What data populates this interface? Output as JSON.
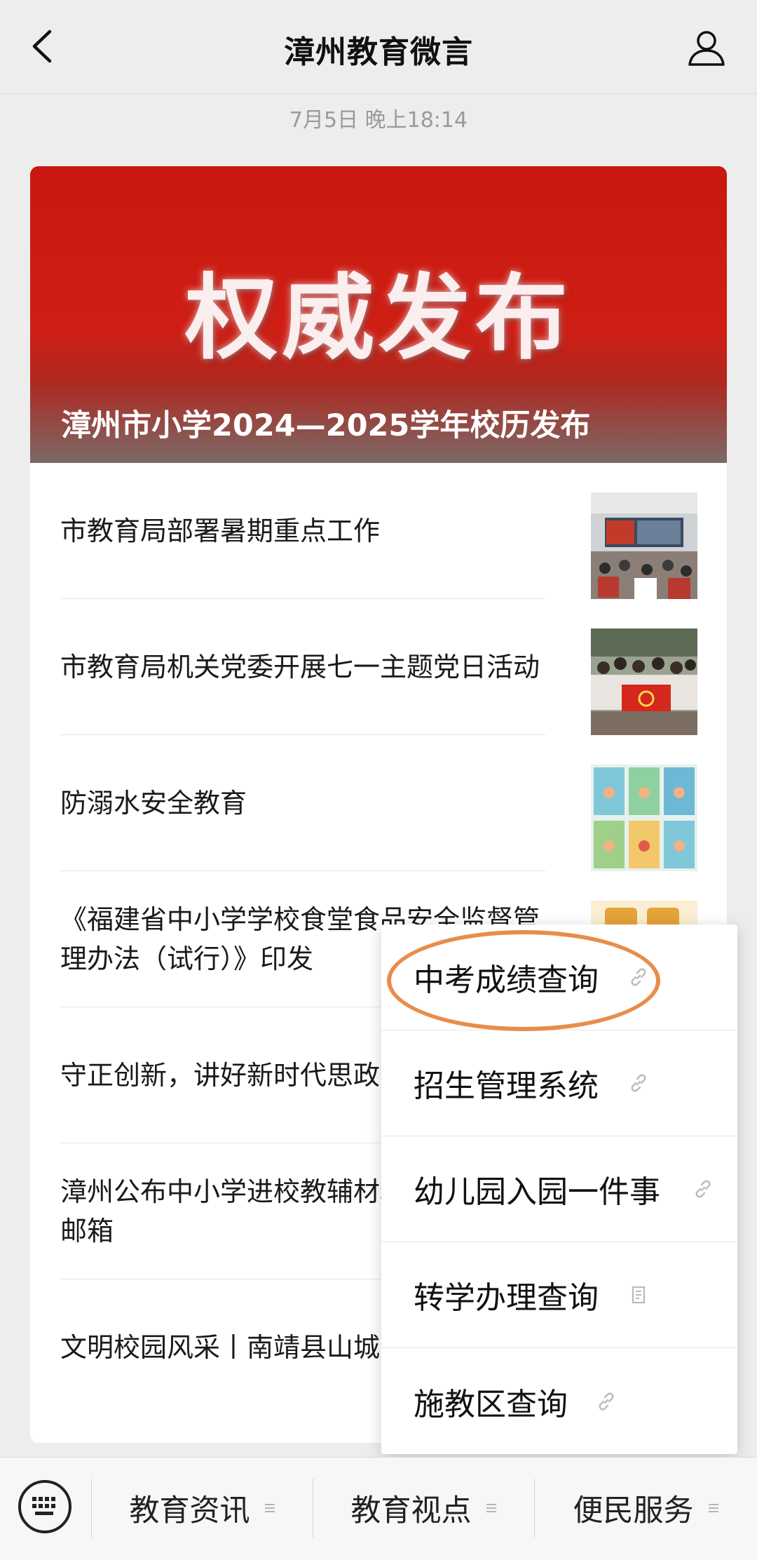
{
  "header": {
    "title": "漳州教育微言",
    "back_icon": "chevron-left-icon",
    "profile_icon": "person-icon"
  },
  "timestamp": "7月5日 晚上18:14",
  "article": {
    "banner_text": "权威发布",
    "banner_caption": "漳州市小学2024—2025学年校历发布",
    "items": [
      {
        "title": "市教育局部署暑期重点工作"
      },
      {
        "title": "市教育局机关党委开展七一主题党日活动"
      },
      {
        "title": "防溺水安全教育"
      },
      {
        "title": "《福建省中小学学校食堂食品安全监督管理办法（试行）》印发"
      },
      {
        "title": "守正创新，讲好新时代思政"
      },
      {
        "title": "漳州公布中小学进校教辅材料举报电话和邮箱"
      },
      {
        "title": "文明校园风采丨南靖县山城"
      }
    ]
  },
  "popup_menu": {
    "items": [
      {
        "label": "中考成绩查询",
        "icon": "link-icon"
      },
      {
        "label": "招生管理系统",
        "icon": "link-icon"
      },
      {
        "label": "幼儿园入园一件事",
        "icon": "link-icon"
      },
      {
        "label": "转学办理查询",
        "icon": "document-icon"
      },
      {
        "label": "施教区查询",
        "icon": "link-icon"
      }
    ],
    "highlight_color": "#e88d4c"
  },
  "bottom_menu": {
    "keyboard_icon": "keyboard-icon",
    "tabs": [
      {
        "label": "教育资讯"
      },
      {
        "label": "教育视点"
      },
      {
        "label": "便民服务"
      }
    ]
  },
  "colors": {
    "banner_red": "#c8170f",
    "background": "#ededed"
  }
}
